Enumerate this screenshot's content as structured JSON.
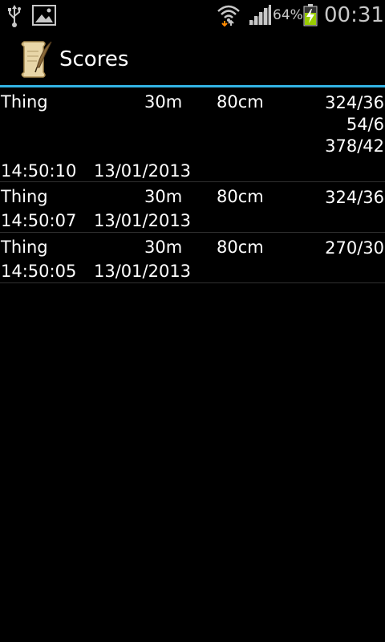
{
  "status_bar": {
    "battery_percent": "64%",
    "clock": "00:31"
  },
  "action_bar": {
    "title": "Scores"
  },
  "rows": [
    {
      "name": "Thing",
      "distance": "30m",
      "size": "80cm",
      "scores": [
        "324/36",
        "54/6",
        "378/42"
      ],
      "time": "14:50:10",
      "date": "13/01/2013"
    },
    {
      "name": "Thing",
      "distance": "30m",
      "size": "80cm",
      "scores": [
        "324/36"
      ],
      "time": "14:50:07",
      "date": "13/01/2013"
    },
    {
      "name": "Thing",
      "distance": "30m",
      "size": "80cm",
      "scores": [
        "270/30"
      ],
      "time": "14:50:05",
      "date": "13/01/2013"
    }
  ],
  "colors": {
    "accent_blue": "#33b5e5",
    "battery_green": "#99cc00",
    "download_orange": "#ff8800"
  }
}
